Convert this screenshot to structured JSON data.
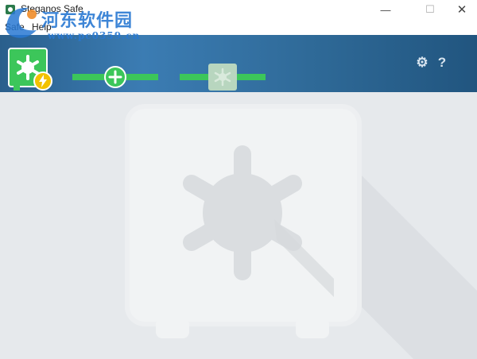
{
  "window": {
    "title": "Steganos Safe",
    "minimize_glyph": "—",
    "maximize_glyph": "☐",
    "close_glyph": "✕"
  },
  "menu": {
    "items": [
      {
        "label": "Safe"
      },
      {
        "label": "Help"
      }
    ]
  },
  "watermark": {
    "text": "河东软件园",
    "url": "www.pc0359.cn"
  },
  "toolbar": {
    "settings_icon": "gear-icon",
    "help_icon": "question-icon",
    "help_glyph": "?",
    "settings_glyph": "⚙"
  },
  "colors": {
    "accent_green": "#3cc65a",
    "toolbar_blue": "#2f6a98",
    "badge_yellow": "#f2c200",
    "background": "#e6e9ec"
  }
}
